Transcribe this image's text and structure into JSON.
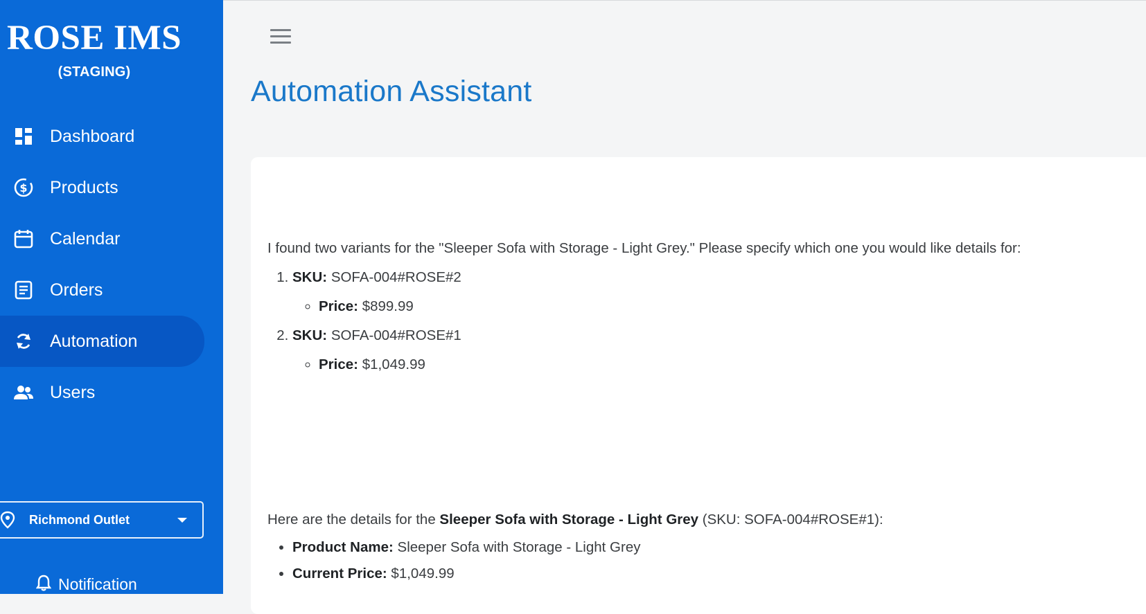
{
  "sidebar": {
    "brand_title": "ROSE IMS",
    "brand_subtitle": "(STAGING)",
    "nav": [
      {
        "label": "Dashboard",
        "icon": "dashboard-icon",
        "active": false
      },
      {
        "label": "Products",
        "icon": "products-icon",
        "active": false
      },
      {
        "label": "Calendar",
        "icon": "calendar-icon",
        "active": false
      },
      {
        "label": "Orders",
        "icon": "orders-icon",
        "active": false
      },
      {
        "label": "Automation",
        "icon": "automation-icon",
        "active": true
      },
      {
        "label": "Users",
        "icon": "users-icon",
        "active": false
      }
    ],
    "location": {
      "label": "Richmond Outlet",
      "icon": "location-pin-icon"
    },
    "notification": {
      "label": "Notification",
      "icon": "bell-icon"
    }
  },
  "header": {
    "menu_icon": "hamburger-menu-icon",
    "title": "Automation Assistant"
  },
  "chat": {
    "message1": {
      "intro": "I found two variants for the \"Sleeper Sofa with Storage - Light Grey.\" Please specify which one you would like details for:",
      "variants": [
        {
          "sku_label": "SKU:",
          "sku": "SOFA-004#ROSE#2",
          "price_label": "Price:",
          "price": "$899.99"
        },
        {
          "sku_label": "SKU:",
          "sku": "SOFA-004#ROSE#1",
          "price_label": "Price:",
          "price": "$1,049.99"
        }
      ]
    },
    "message2": {
      "intro_prefix": "Here are the details for the ",
      "product_bold": "Sleeper Sofa with Storage - Light Grey",
      "intro_suffix": " (SKU: SOFA-004#ROSE#1):",
      "details": [
        {
          "label": "Product Name:",
          "value": "Sleeper Sofa with Storage - Light Grey"
        },
        {
          "label": "Current Price:",
          "value": "$1,049.99"
        }
      ]
    }
  },
  "colors": {
    "sidebar_bg": "#0a6ad8",
    "active_bg": "#0757c4",
    "title_blue": "#1a78c9"
  }
}
